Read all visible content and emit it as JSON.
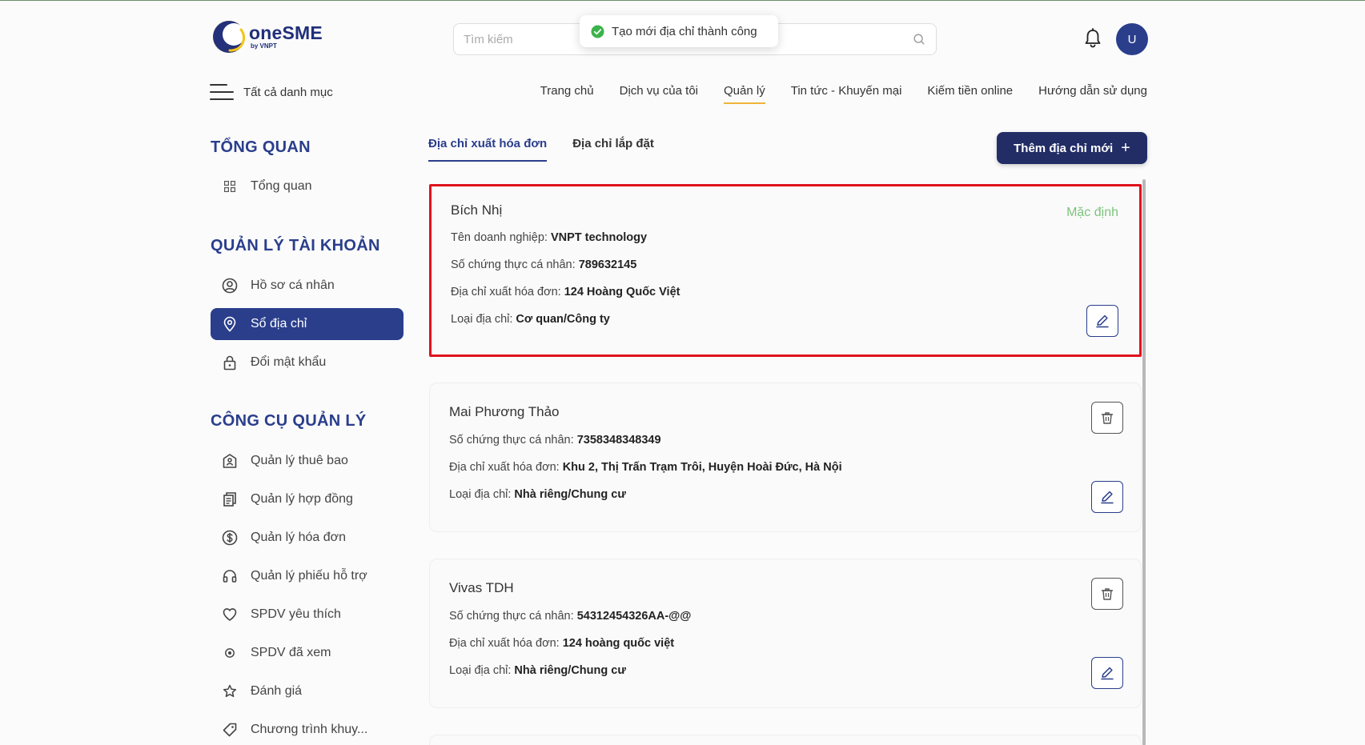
{
  "header": {
    "logo_name": "oneSME",
    "logo_sub": "by VNPT",
    "search_placeholder": "Tìm kiếm",
    "avatar_letter": "U",
    "all_categories": "Tất cả danh mục"
  },
  "toast": {
    "message": "Tạo mới địa chỉ thành công"
  },
  "topnav": {
    "items": [
      "Trang chủ",
      "Dịch vụ của tôi",
      "Quản lý",
      "Tin tức - Khuyến mại",
      "Kiếm tiền online",
      "Hướng dẫn sử dụng"
    ],
    "active_index": 2
  },
  "sidebar": {
    "overview_title": "TỔNG QUAN",
    "overview_item": "Tổng quan",
    "account_title": "QUẢN LÝ TÀI KHOẢN",
    "account_items": [
      "Hồ sơ cá nhân",
      "Sổ địa chỉ",
      "Đổi mật khẩu"
    ],
    "tools_title": "CÔNG CỤ QUẢN LÝ",
    "tools_items": [
      "Quản lý thuê bao",
      "Quản lý hợp đồng",
      "Quản lý hóa đơn",
      "Quản lý phiếu hỗ trợ",
      "SPDV yêu thích",
      "SPDV đã xem",
      "Đánh giá",
      "Chương trình khuy..."
    ]
  },
  "main": {
    "tabs": [
      "Địa chỉ xuất hóa đơn",
      "Địa chỉ lắp đặt"
    ],
    "add_button": "Thêm địa chỉ mới",
    "default_label": "Mặc định",
    "labels": {
      "company": "Tên doanh nghiệp: ",
      "id": "Số chứng thực cá nhân: ",
      "invoice_address": "Địa chỉ xuất hóa đơn: ",
      "address_type": "Loại địa chỉ: "
    },
    "cards": [
      {
        "name": "Bích Nhị",
        "company": "VNPT technology",
        "id": "789632145",
        "invoice_address": "124 Hoàng Quốc Việt",
        "address_type": "Cơ quan/Công ty"
      },
      {
        "name": "Mai Phương Thảo",
        "id": "7358348348349",
        "invoice_address": "Khu 2, Thị Trấn Trạm Trôi, Huyện Hoài Đức, Hà Nội",
        "address_type": "Nhà riêng/Chung cư"
      },
      {
        "name": "Vivas TDH",
        "id": "54312454326AA-@@",
        "invoice_address": "124 hoàng quốc việt",
        "address_type": "Nhà riêng/Chung cư"
      }
    ]
  },
  "colors": {
    "brand": "#2a3e8c",
    "button_dark": "#222d66",
    "highlight_border": "#e0121c",
    "default_badge": "#7dc47d",
    "nav_active_underline": "#f0b43a"
  }
}
